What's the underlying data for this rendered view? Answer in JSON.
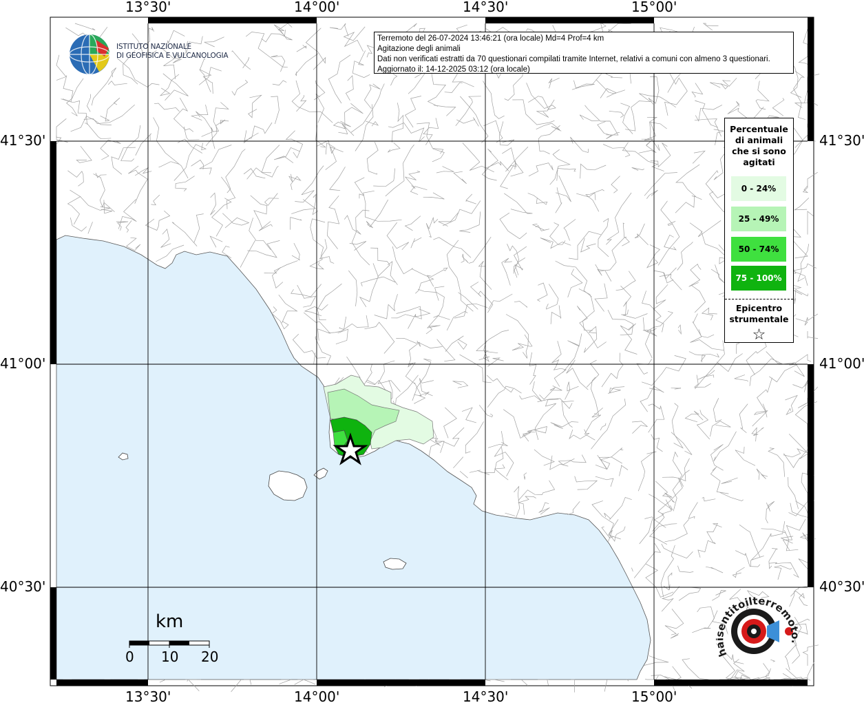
{
  "info": {
    "line1": "Terremoto del 26-07-2024 13:46:21 (ora locale) Md=4 Prof=4 km",
    "line2": "Agitazione degli animali",
    "line3": "Dati non verificati estratti da 70 questionari compilati tramite Internet, relativi a comuni con almeno 3 questionari.",
    "line4": "Aggiornato il: 14-12-2025 03:12 (ora locale)"
  },
  "institute": {
    "line1": "ISTITUTO NAZIONALE",
    "line2": "DI GEOFISICA E VULCANOLOGIA"
  },
  "axes": {
    "lon_labels": [
      "13°30'",
      "14°00'",
      "14°30'",
      "15°00'"
    ],
    "lat_labels": [
      "41°30'",
      "41°00'",
      "40°30'"
    ]
  },
  "legend": {
    "title_lines": [
      "Percentuale",
      "di animali",
      "che si sono",
      "agitati"
    ],
    "classes": [
      {
        "label": "0 - 24%",
        "color": "#e3fbe3",
        "text_color": "#000000"
      },
      {
        "label": "25 - 49%",
        "color": "#b6f4b6",
        "text_color": "#000000"
      },
      {
        "label": "50 - 74%",
        "color": "#3fe03f",
        "text_color": "#000000"
      },
      {
        "label": "75 - 100%",
        "color": "#0fb30f",
        "text_color": "#ffffff"
      }
    ],
    "epicenter_lines": [
      "Epicentro",
      "strumentale"
    ],
    "epicenter_symbol": "☆"
  },
  "scale": {
    "unit": "km",
    "ticks": [
      "0",
      "10",
      "20"
    ]
  },
  "colors": {
    "sea": "#e0f1fc",
    "land": "#ffffff",
    "border": "#9a9a9a",
    "grid": "#000000"
  },
  "logo_text": "haisentitoilterremoto.it"
}
